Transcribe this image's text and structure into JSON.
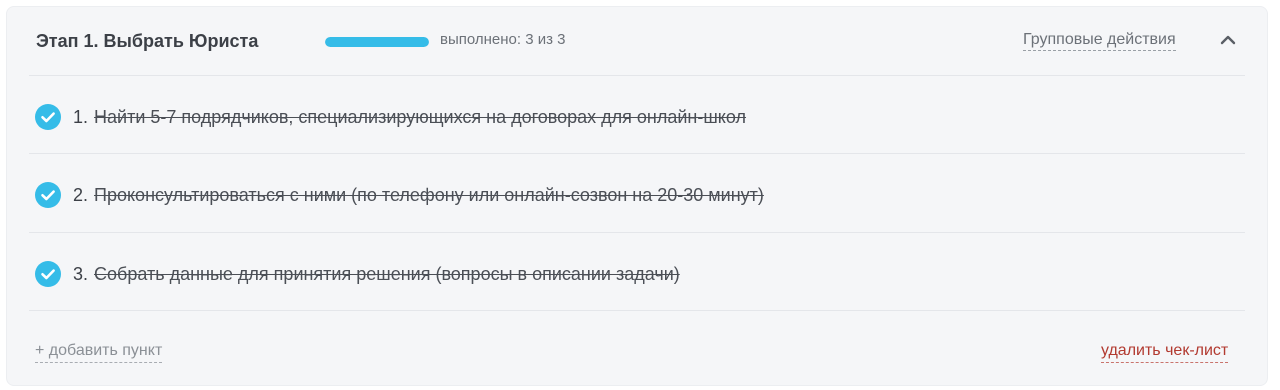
{
  "stage": {
    "title": "Этап 1. Выбрать Юриста",
    "progress": {
      "completed": 3,
      "total": 3,
      "fraction": 1.0,
      "label": "выполнено: 3 из 3",
      "color": "#35bce8"
    },
    "group_actions_label": "Групповые действия",
    "collapse_icon": "chevron-up-icon"
  },
  "checklist": {
    "items": [
      {
        "number": "1.",
        "text": "Найти 5-7 подрядчиков, специализирующихся на договорах для онлайн-школ",
        "done": true
      },
      {
        "number": "2.",
        "text": "Проконсультироваться с ними (по телефону или онлайн-созвон на 20-30 минут)",
        "done": true
      },
      {
        "number": "3.",
        "text": "Собрать данные для принятия решения (вопросы в описании задачи)",
        "done": true
      }
    ],
    "check_icon": "checkmark-circle-icon",
    "check_color": "#35bce8"
  },
  "footer": {
    "add_item_label": "+ добавить пункт",
    "delete_checklist_label": "удалить чек-лист",
    "delete_color": "#b23a30"
  }
}
